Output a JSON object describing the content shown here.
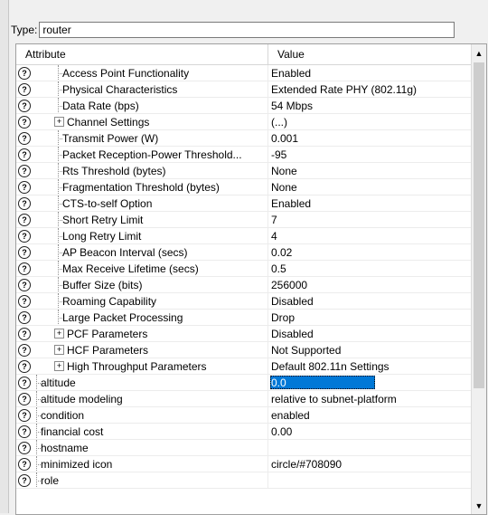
{
  "type_field": {
    "label": "Type:",
    "value": "router"
  },
  "columns": {
    "attribute": "Attribute",
    "value": "Value"
  },
  "rows": [
    {
      "name": "Access Point Functionality",
      "value": "Enabled",
      "level": 2
    },
    {
      "name": "Physical Characteristics",
      "value": "Extended Rate PHY (802.11g)",
      "level": 2
    },
    {
      "name": "Data Rate (bps)",
      "value": "54 Mbps",
      "level": 2
    },
    {
      "name": "Channel Settings",
      "value": "(...)",
      "level": 2,
      "expandable": true
    },
    {
      "name": "Transmit Power (W)",
      "value": "0.001",
      "level": 2
    },
    {
      "name": "Packet Reception-Power Threshold...",
      "value": "-95",
      "level": 2
    },
    {
      "name": "Rts Threshold (bytes)",
      "value": "None",
      "level": 2
    },
    {
      "name": "Fragmentation Threshold (bytes)",
      "value": "None",
      "level": 2
    },
    {
      "name": "CTS-to-self Option",
      "value": "Enabled",
      "level": 2
    },
    {
      "name": "Short Retry Limit",
      "value": "7",
      "level": 2
    },
    {
      "name": "Long Retry Limit",
      "value": "4",
      "level": 2
    },
    {
      "name": "AP Beacon Interval (secs)",
      "value": "0.02",
      "level": 2
    },
    {
      "name": "Max Receive Lifetime (secs)",
      "value": "0.5",
      "level": 2
    },
    {
      "name": "Buffer Size (bits)",
      "value": "256000",
      "level": 2
    },
    {
      "name": "Roaming Capability",
      "value": "Disabled",
      "level": 2
    },
    {
      "name": "Large Packet Processing",
      "value": "Drop",
      "level": 2
    },
    {
      "name": "PCF Parameters",
      "value": "Disabled",
      "level": 2,
      "expandable": true
    },
    {
      "name": "HCF Parameters",
      "value": "Not Supported",
      "level": 2,
      "expandable": true
    },
    {
      "name": "High Throughput Parameters",
      "value": "Default 802.11n Settings",
      "level": 2,
      "expandable": true
    },
    {
      "name": "altitude",
      "value": "0.0",
      "level": 0,
      "selected": true
    },
    {
      "name": "altitude modeling",
      "value": "relative to subnet-platform",
      "level": 0
    },
    {
      "name": "condition",
      "value": "enabled",
      "level": 0
    },
    {
      "name": "financial cost",
      "value": "0.00",
      "level": 0
    },
    {
      "name": "hostname",
      "value": "",
      "level": 0
    },
    {
      "name": "minimized icon",
      "value": "circle/#708090",
      "level": 0
    },
    {
      "name": "role",
      "value": "",
      "level": 0
    }
  ],
  "icons": {
    "help": "help-question-icon",
    "expand": "plus-expander-icon",
    "scroll_up": "up-arrow-icon",
    "scroll_down": "down-arrow-icon"
  },
  "help_glyph": "?",
  "expand_glyph": "+",
  "selection_color": "#0078d7",
  "scroll_up_glyph": "▲",
  "scroll_down_glyph": "▼"
}
